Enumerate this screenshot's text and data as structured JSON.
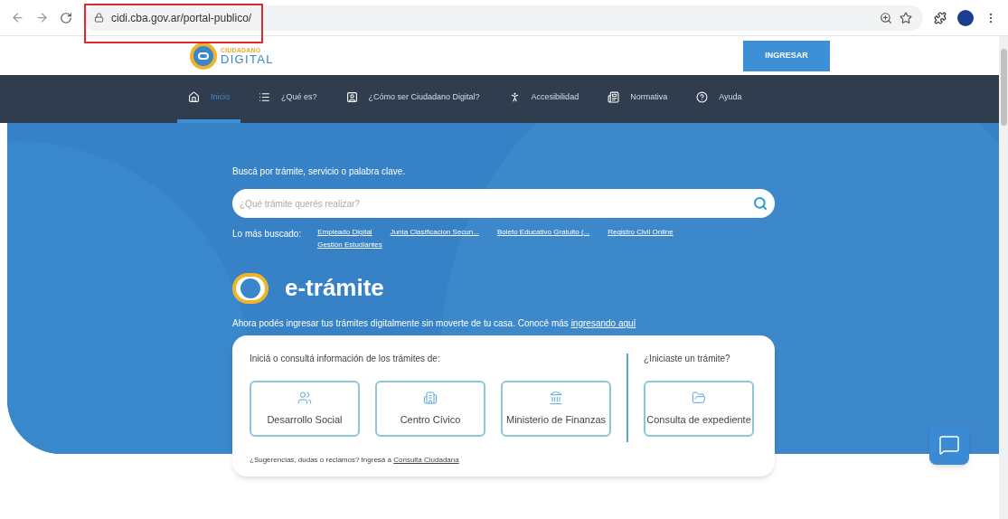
{
  "browser": {
    "url": "cidi.cba.gov.ar/portal-publico/"
  },
  "header": {
    "logo_top": "CIUDADANO",
    "logo_bottom": "DIGITAL",
    "login_button": "INGRESAR"
  },
  "nav": [
    {
      "label": "Inicio",
      "selected": true
    },
    {
      "label": "¿Qué es?",
      "selected": false
    },
    {
      "label": "¿Cómo ser Ciudadano Digital?",
      "selected": false
    },
    {
      "label": "Accesibilidad",
      "selected": false
    },
    {
      "label": "Normativa",
      "selected": false
    },
    {
      "label": "Ayuda",
      "selected": false
    }
  ],
  "search": {
    "label": "Buscá por trámite, servicio o palabra clave.",
    "placeholder": "¿Qué trámite querés realizar?"
  },
  "popular": {
    "label": "Lo más buscado:",
    "links": [
      "Empleado Digital",
      "Junta Clasificacion Secun...",
      "Boleto Educativo Gratuito (...",
      "Registro Civil Online",
      "Gestión Estudiantes"
    ]
  },
  "etramite": {
    "title": "e-trámite",
    "intro": "Ahora podés ingresar tus trámites digitalmente sin moverte de tu casa. Conocé más",
    "intro_link": "ingresando aquí"
  },
  "card": {
    "left_heading": "Iniciá o consultá información de los trámites de:",
    "options": [
      {
        "label": "Desarrollo Social"
      },
      {
        "label": "Centro Cívico"
      },
      {
        "label": "Ministerio de Finanzas"
      }
    ],
    "right_heading": "¿Iniciaste un trámite?",
    "right_option": {
      "label": "Consulta de expediente"
    },
    "footer": "¿Sugerencias, dudas o reclamos? Ingresá a",
    "footer_link": "Consulta Ciudadana"
  }
}
